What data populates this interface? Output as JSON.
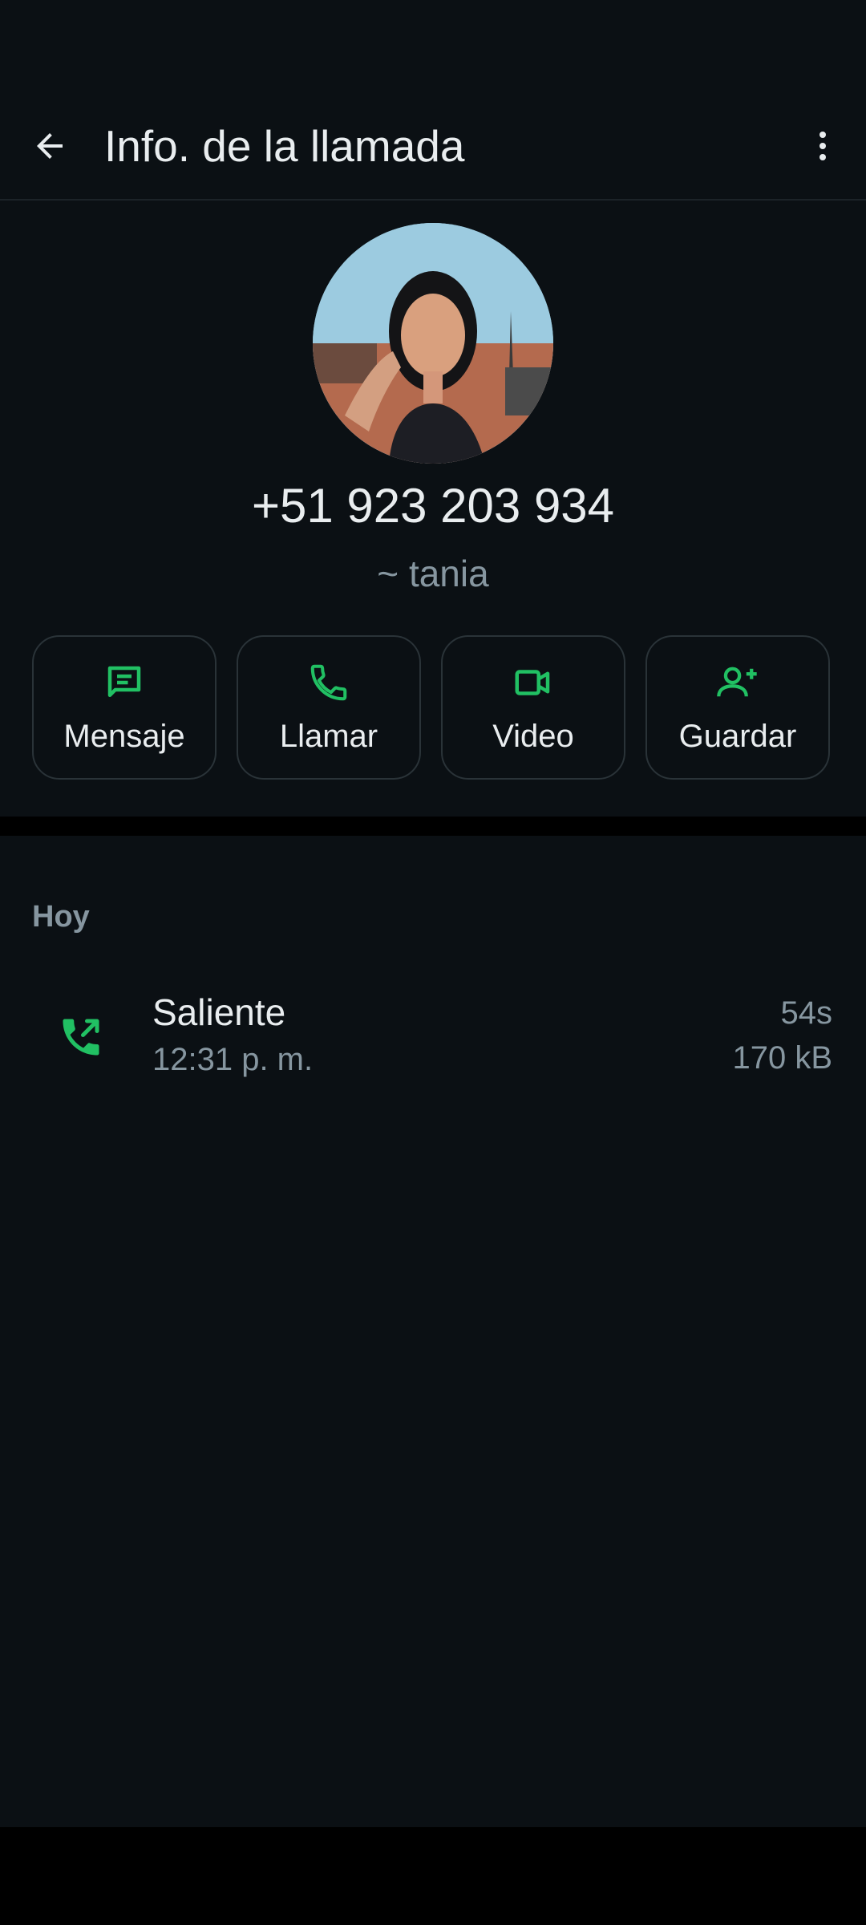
{
  "header": {
    "title": "Info. de la llamada",
    "back_icon": "arrow-left-icon",
    "more_icon": "more-vertical-icon"
  },
  "contact": {
    "phone": "+51 923 203 934",
    "push_name": "~ tania"
  },
  "actions": [
    {
      "label": "Mensaje",
      "icon": "message-icon"
    },
    {
      "label": "Llamar",
      "icon": "phone-icon"
    },
    {
      "label": "Video",
      "icon": "video-icon"
    },
    {
      "label": "Guardar",
      "icon": "add-contact-icon"
    }
  ],
  "history": {
    "section_title": "Hoy",
    "calls": [
      {
        "type": "Saliente",
        "time": "12:31 p. m.",
        "duration": "54s",
        "size": "170 kB",
        "icon": "outgoing-call-icon"
      }
    ]
  },
  "colors": {
    "background": "#0b1014",
    "accent": "#21c063",
    "text_primary": "#e9edef",
    "text_secondary": "#8696a0"
  }
}
